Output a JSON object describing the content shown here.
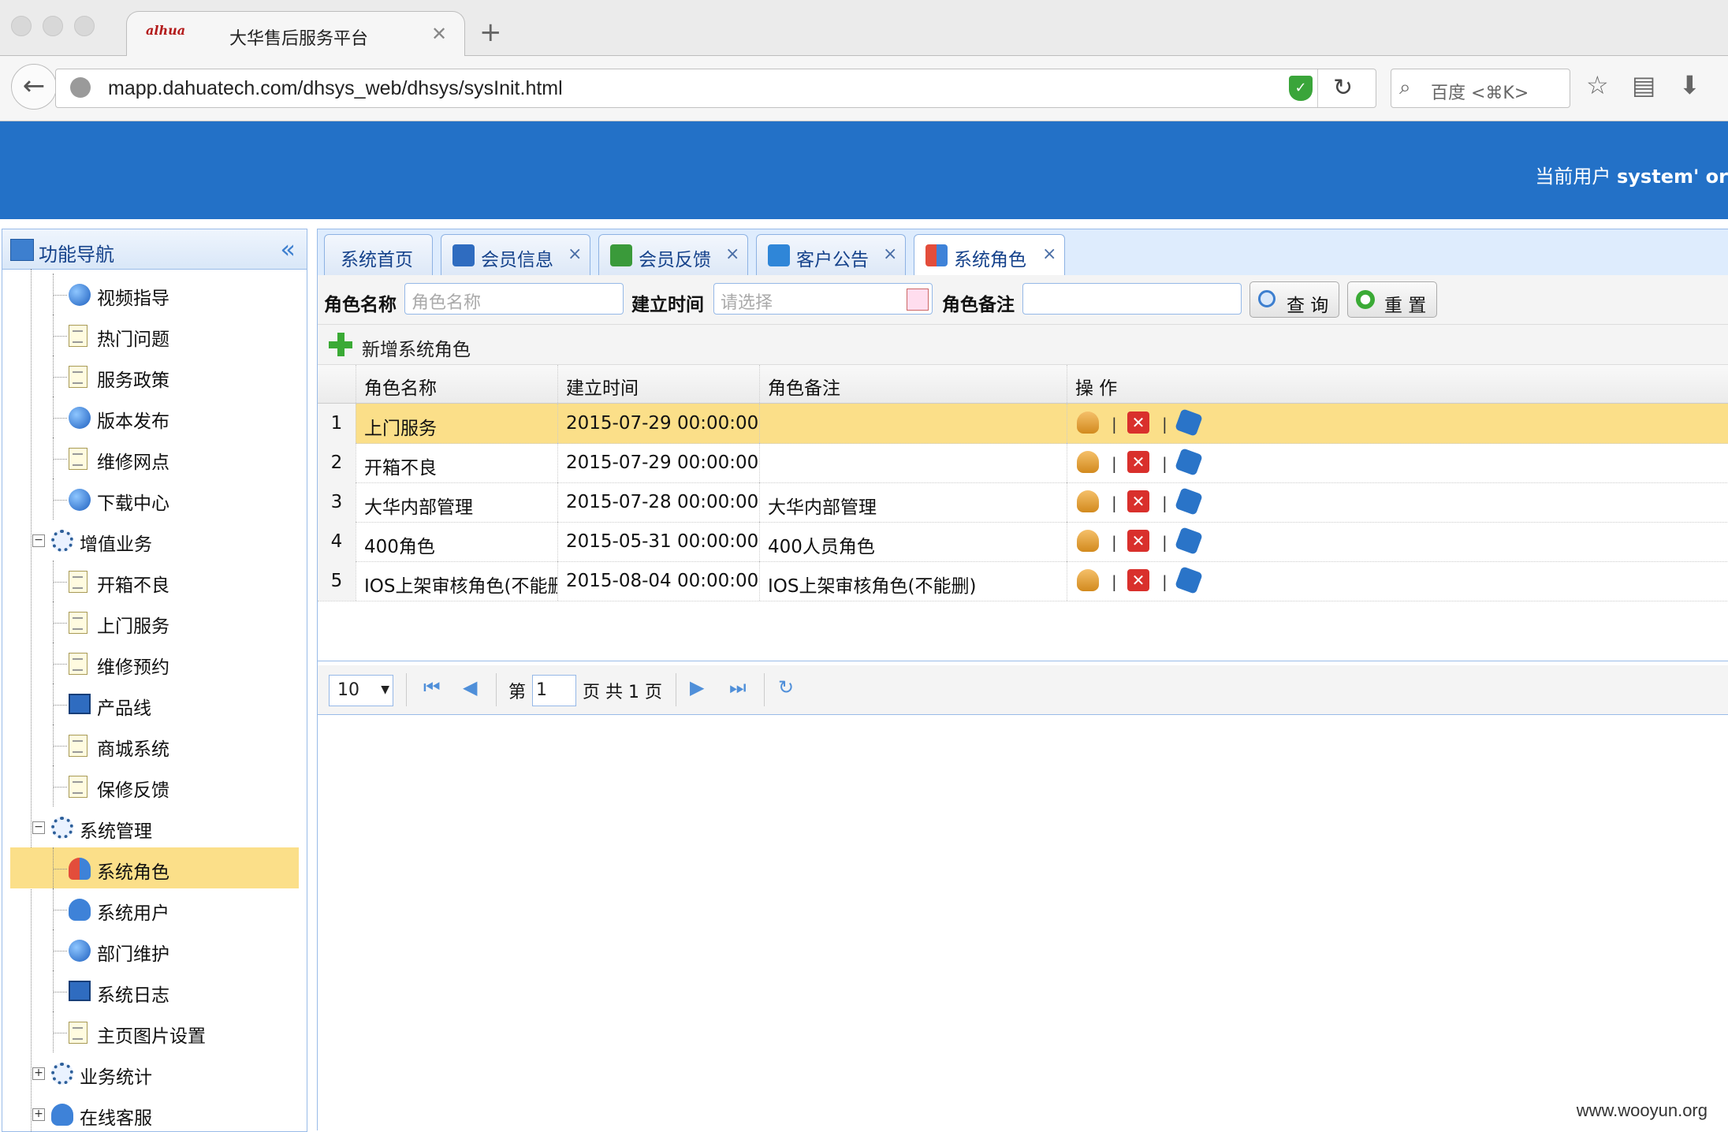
{
  "browser": {
    "tab_title": "大华售后服务平台",
    "tab_logo_text": "alhua",
    "url": "mapp.dahuatech.com/dhsys_web/dhsys/sysInit.html",
    "search_placeholder": "百度 <⌘K>"
  },
  "header": {
    "current_user_prefix": "当前用户 ",
    "current_user_value": "system' or"
  },
  "sidebar": {
    "title": "功能导航",
    "items": [
      {
        "label": "视频指导",
        "icon": "globe-icon",
        "level": 2
      },
      {
        "label": "热门问题",
        "icon": "document-icon",
        "level": 2
      },
      {
        "label": "服务政策",
        "icon": "document-icon",
        "level": 2
      },
      {
        "label": "版本发布",
        "icon": "globe-icon",
        "level": 2
      },
      {
        "label": "维修网点",
        "icon": "document-icon",
        "level": 2
      },
      {
        "label": "下载中心",
        "icon": "globe-icon",
        "level": 2
      },
      {
        "label": "增值业务",
        "icon": "gear-icon",
        "level": 1,
        "expander": "−"
      },
      {
        "label": "开箱不良",
        "icon": "document-icon",
        "level": 2
      },
      {
        "label": "上门服务",
        "icon": "document-icon",
        "level": 2
      },
      {
        "label": "维修预约",
        "icon": "document-icon",
        "level": 2
      },
      {
        "label": "产品线",
        "icon": "monitor-icon",
        "level": 2
      },
      {
        "label": "商城系统",
        "icon": "document-icon",
        "level": 2
      },
      {
        "label": "保修反馈",
        "icon": "document-icon",
        "level": 2
      },
      {
        "label": "系统管理",
        "icon": "gear-icon",
        "level": 1,
        "expander": "−"
      },
      {
        "label": "系统角色",
        "icon": "role-icon",
        "level": 2,
        "selected": true
      },
      {
        "label": "系统用户",
        "icon": "user-icon",
        "level": 2
      },
      {
        "label": "部门维护",
        "icon": "globe-icon",
        "level": 2
      },
      {
        "label": "系统日志",
        "icon": "monitor-icon",
        "level": 2
      },
      {
        "label": "主页图片设置",
        "icon": "document-icon",
        "level": 2
      },
      {
        "label": "业务统计",
        "icon": "gear-icon",
        "level": 1,
        "expander": "+"
      },
      {
        "label": "在线客服",
        "icon": "user-icon",
        "level": 1,
        "expander": "+"
      }
    ]
  },
  "tabs": [
    {
      "label": "系统首页",
      "closable": false
    },
    {
      "label": "会员信息",
      "closable": true,
      "icon": "member-icon"
    },
    {
      "label": "会员反馈",
      "closable": true,
      "icon": "feedback-icon"
    },
    {
      "label": "客户公告",
      "closable": true,
      "icon": "notice-icon"
    },
    {
      "label": "系统角色",
      "closable": true,
      "icon": "role-icon",
      "active": true
    }
  ],
  "filter": {
    "role_name_label": "角色名称",
    "role_name_placeholder": "角色名称",
    "created_label": "建立时间",
    "created_placeholder": "请选择",
    "remark_label": "角色备注",
    "remark_value": "",
    "query_button": "查 询",
    "reset_button": "重 置"
  },
  "grid": {
    "add_label": "新增系统角色",
    "columns": [
      "角色名称",
      "建立时间",
      "角色备注",
      "操 作"
    ],
    "rows": [
      {
        "num": "1",
        "name": "上门服务",
        "created": "2015-07-29 00:00:00",
        "remark": ""
      },
      {
        "num": "2",
        "name": "开箱不良",
        "created": "2015-07-29 00:00:00",
        "remark": ""
      },
      {
        "num": "3",
        "name": "大华内部管理",
        "created": "2015-07-28 00:00:00",
        "remark": "大华内部管理"
      },
      {
        "num": "4",
        "name": "400角色",
        "created": "2015-05-31 00:00:00",
        "remark": "400人员角色"
      },
      {
        "num": "5",
        "name": "IOS上架审核角色(不能删)",
        "created": "2015-08-04 00:00:00",
        "remark": "IOS上架审核角色(不能删)"
      }
    ]
  },
  "pager": {
    "page_size": "10",
    "page_prefix": "第",
    "page_value": "1",
    "page_suffix": "页 共 1 页"
  },
  "watermark": "www.wooyun.org"
}
